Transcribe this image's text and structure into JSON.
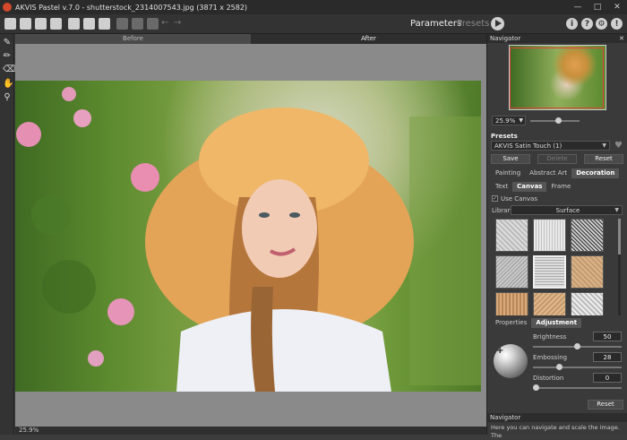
{
  "window": {
    "title": "AKVIS Pastel v.7.0 - shutterstock_2314007543.jpg (3871 x 2582)"
  },
  "toolbar": {
    "parameters_label": "Parameters",
    "presets_label": "Presets"
  },
  "view_tabs": {
    "before": "Before",
    "after": "After"
  },
  "status": {
    "zoom": "25.9%"
  },
  "navigator": {
    "title": "Navigator",
    "zoom_value": "25.9%"
  },
  "presets": {
    "title": "Presets",
    "selected": "AKVIS Satin Touch (1)",
    "save": "Save",
    "delete": "Delete",
    "reset": "Reset"
  },
  "main_tabs": [
    "Painting",
    "Abstract Art",
    "Decoration"
  ],
  "sub_tabs": [
    "Text",
    "Canvas",
    "Frame"
  ],
  "canvas": {
    "use_canvas_label": "Use Canvas",
    "library_label": "Library",
    "library_value": "Surface"
  },
  "props_tabs": [
    "Properties",
    "Adjustment"
  ],
  "adjustment": {
    "brightness_label": "Brightness",
    "brightness_value": "50",
    "brightness_level": 50,
    "embossing_label": "Embossing",
    "embossing_value": "28",
    "embossing_level": 28,
    "distortion_label": "Distortion",
    "distortion_value": "0",
    "distortion_level": 0,
    "reset": "Reset"
  },
  "help": {
    "title": "Navigator",
    "text": "Here you can navigate and scale the image. The"
  }
}
